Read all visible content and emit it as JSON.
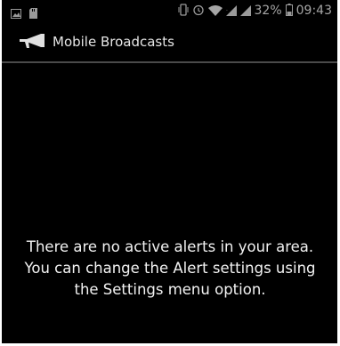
{
  "status_bar": {
    "battery_percent": "32%",
    "time": "09:43",
    "left_icons": [
      "screenshot-icon",
      "sd-card-icon"
    ],
    "right_icons": [
      "vibrate-icon",
      "alarm-icon",
      "wifi-icon",
      "signal-icon",
      "signal-icon",
      "battery-icon"
    ]
  },
  "action_bar": {
    "title": "Mobile Broadcasts",
    "icon": "megaphone-icon"
  },
  "content": {
    "empty_message": "There are no active alerts in your area. You can change the Alert settings using the Settings menu option."
  },
  "colors": {
    "background": "#000000",
    "text": "#f2f2f2",
    "status_icon": "#9a9a9a"
  }
}
